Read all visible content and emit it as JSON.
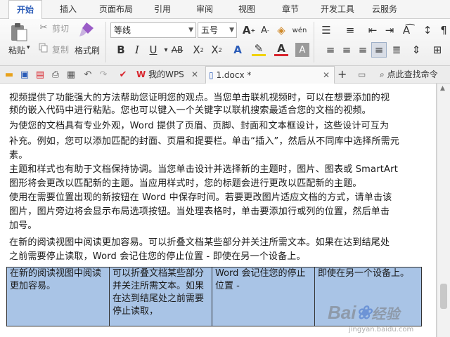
{
  "menu": {
    "tabs": [
      "开始",
      "插入",
      "页面布局",
      "引用",
      "审阅",
      "视图",
      "章节",
      "开发工具",
      "云服务"
    ],
    "active": "开始"
  },
  "ribbon": {
    "paste_label": "粘贴",
    "cut_label": "剪切",
    "copy_label": "复制",
    "format_painter_label": "格式刷",
    "font_name": "等线",
    "font_size": "五号"
  },
  "tabs_bar": {
    "wps_tab": "我的WPS",
    "doc_tab": "1.docx *",
    "add_tab": "+",
    "find_command": "点此查找命令"
  },
  "document": {
    "lines": [
      "视频提供了功能强大的方法帮助您证明您的观点。当您单击联机视频时，可以在想要添加的视",
      "频的嵌入代码中进行粘贴。您也可以键入一个关键字以联机搜索最适合您的文档的视频。",
      "为使您的文档具有专业外观，Word 提供了页眉、页脚、封面和文本框设计，这些设计可互为",
      "补充。例如，您可以添加匹配的封面、页眉和提要栏。单击“插入”，然后从不同库中选择所需元",
      "素。",
      "主题和样式也有助于文档保持协调。当您单击设计并选择新的主题时，图片、图表或 SmartArt",
      "图形将会更改以匹配新的主题。当应用样式时，您的标题会进行更改以匹配新的主题。",
      "使用在需要位置出现的新按钮在 Word 中保存时间。若要更改图片适应文档的方式，请单击该",
      "图片，图片旁边将会显示布局选项按钮。当处理表格时，单击要添加行或列的位置，然后单击",
      "加号。",
      "在新的阅读视图中阅读更加容易。可以折叠文档某些部分并关注所需文本。如果在达到结尾处",
      "之前需要停止读取，Word 会记住您的停止位置 - 即使在另一个设备上。"
    ],
    "table": [
      [
        "在新的阅读视图中阅读更加容易。",
        "可以折叠文档某些部分并关注所需文本。如果在达到结尾处之前需要停止读取，",
        "Word 会记住您的停止位置 -",
        "即使在另一个设备上。"
      ]
    ]
  },
  "watermark": {
    "brand": "Bai",
    "brand2": "经验",
    "url": "jingyan.baidu.com"
  },
  "colors": {
    "accent": "#2b5cb8",
    "table_fill": "#a9c4e6",
    "wps_red": "#d8262e"
  }
}
